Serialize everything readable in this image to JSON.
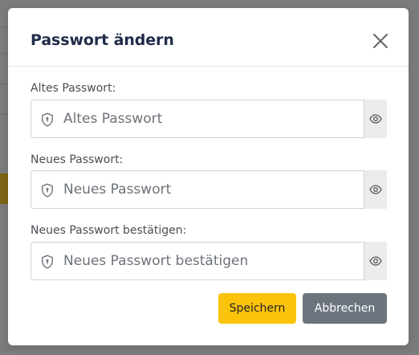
{
  "modal": {
    "title": "Passwort ändern",
    "close_icon": "close-icon",
    "fields": [
      {
        "label": "Altes Passwort:",
        "placeholder": "Altes Passwort",
        "leading_icon": "shield-lock-icon",
        "toggle_icon": "eye-icon"
      },
      {
        "label": "Neues Passwort:",
        "placeholder": "Neues Passwort",
        "leading_icon": "shield-lock-icon",
        "toggle_icon": "eye-icon"
      },
      {
        "label": "Neues Passwort bestätigen:",
        "placeholder": "Neues Passwort bestätigen",
        "leading_icon": "shield-lock-icon",
        "toggle_icon": "eye-icon"
      }
    ],
    "buttons": {
      "save_label": "Speichern",
      "cancel_label": "Abbrechen"
    }
  },
  "colors": {
    "title": "#222c4a",
    "save_button": "#fcc30b",
    "cancel_button": "#6c757d",
    "overlay": "#7b7b7b"
  }
}
